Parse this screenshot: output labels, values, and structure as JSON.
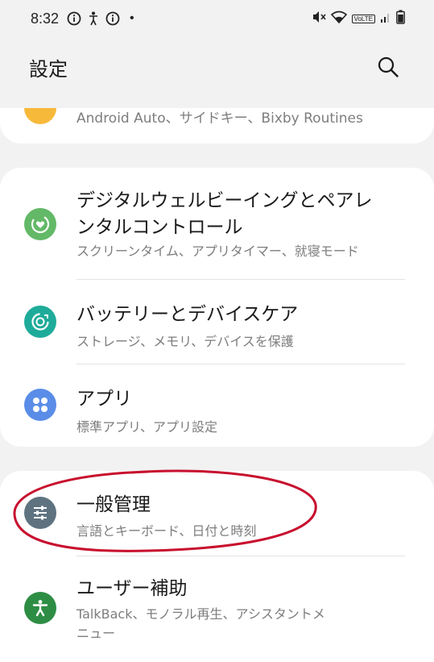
{
  "status_bar": {
    "time": "8:32",
    "bullet": "•",
    "lte_label": "VoLTE"
  },
  "app_bar": {
    "title": "設定"
  },
  "partial_item": {
    "subtitle": "Android Auto、サイドキー、Bixby Routines",
    "icon": "gear-icon",
    "icon_color": "#f6b93a"
  },
  "group_2": [
    {
      "title_line1": "デジタルウェルビーイングとペアレ",
      "title_line2": "ンタルコントロール",
      "subtitle": "スクリーンタイム、アプリタイマー、就寝モード",
      "icon": "heart-circle-icon",
      "icon_color": "#63b967"
    },
    {
      "title": "バッテリーとデバイスケア",
      "subtitle": "ストレージ、メモリ、デバイスを保護",
      "icon": "device-care-icon",
      "icon_color": "#1fab9a"
    },
    {
      "title": "アプリ",
      "subtitle": "標準アプリ、アプリ設定",
      "icon": "apps-grid-icon",
      "icon_color": "#5a8de8"
    }
  ],
  "group_3": [
    {
      "title": "一般管理",
      "subtitle": "言語とキーボード、日付と時刻",
      "icon": "sliders-icon",
      "icon_color": "#5e7280"
    },
    {
      "title": "ユーザー補助",
      "subtitle_line1": "TalkBack、モノラル再生、アシスタントメ",
      "subtitle_line2": "ニュー",
      "icon": "accessibility-icon",
      "icon_color": "#2e8d44"
    }
  ],
  "colors": {
    "background": "#f2f2f2",
    "card": "#ffffff",
    "annotation": "#c8102e"
  }
}
